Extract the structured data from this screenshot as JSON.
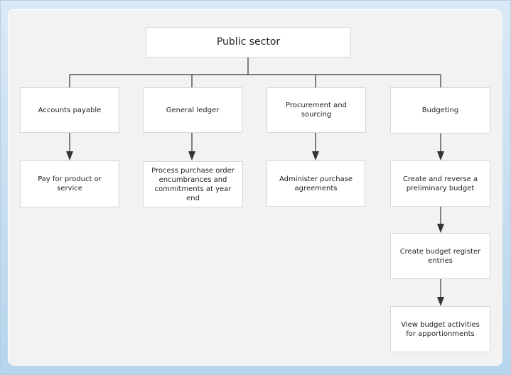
{
  "diagram": {
    "root": {
      "label": "Public sector"
    },
    "modules": [
      {
        "label": "Accounts payable",
        "steps": [
          "Pay for product or service"
        ]
      },
      {
        "label": "General ledger",
        "steps": [
          "Process purchase order encumbrances and commitments at year end"
        ]
      },
      {
        "label": "Procurement and sourcing",
        "steps": [
          "Administer purchase agreements"
        ]
      },
      {
        "label": "Budgeting",
        "steps": [
          "Create and reverse a preliminary budget",
          "Create budget register entries",
          "View budget activities for apportionments"
        ]
      }
    ],
    "colors": {
      "panel": "#f2f2f2",
      "box": "#ffffff",
      "line": "#333333",
      "frame": "#b6d5ec"
    }
  }
}
